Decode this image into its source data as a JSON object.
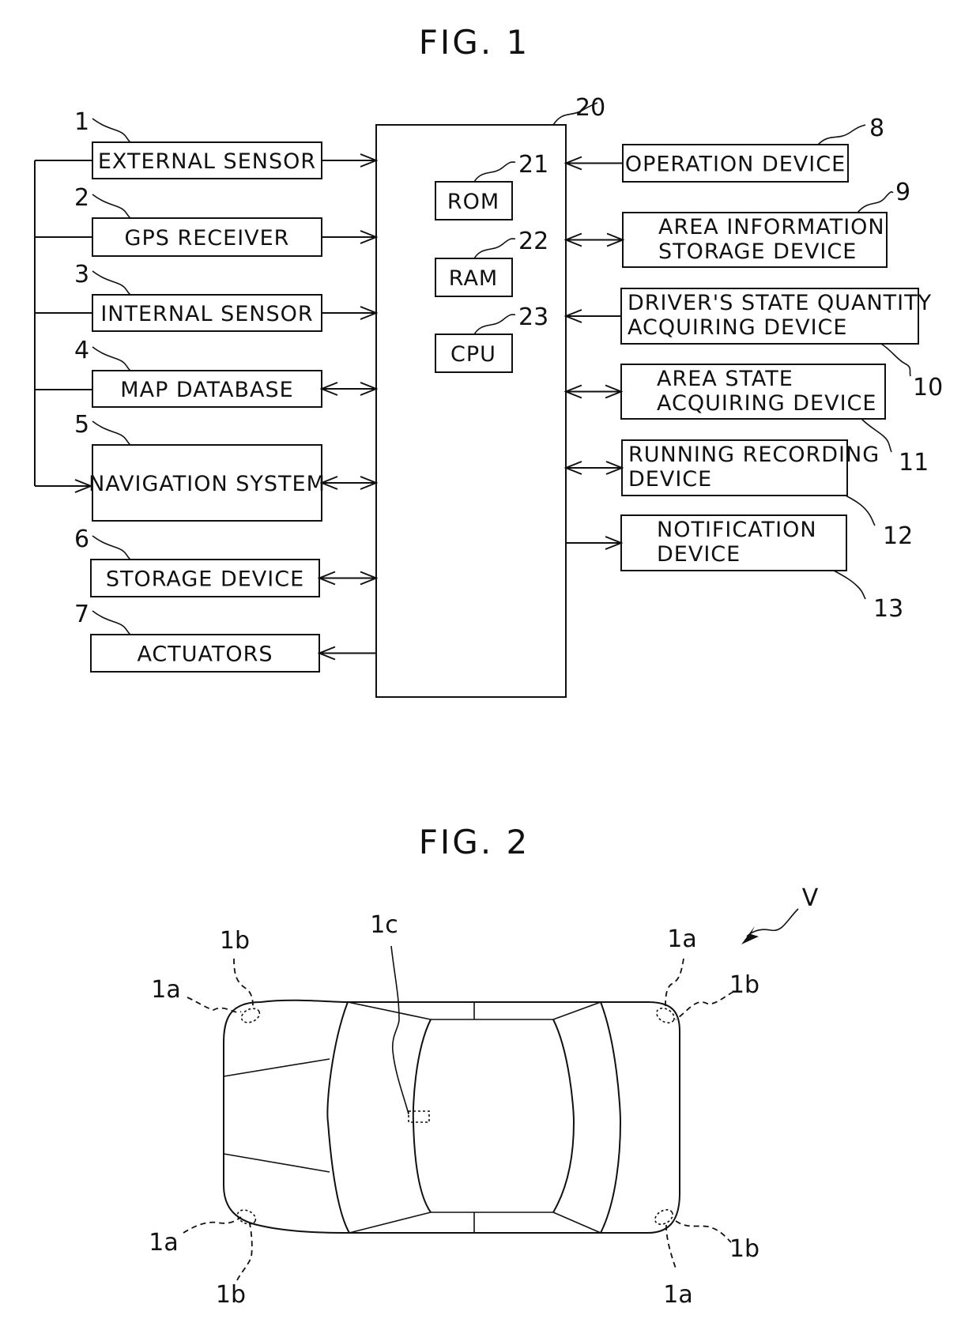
{
  "fig1": {
    "title": "FIG. 1",
    "controller": {
      "ref": "20"
    },
    "internal_blocks": [
      {
        "ref": "21",
        "label": "ROM"
      },
      {
        "ref": "22",
        "label": "RAM"
      },
      {
        "ref": "23",
        "label": "CPU"
      }
    ],
    "left_blocks": [
      {
        "ref": "1",
        "label": "EXTERNAL SENSOR",
        "arrow": "to-controller"
      },
      {
        "ref": "2",
        "label": "GPS RECEIVER",
        "arrow": "to-controller"
      },
      {
        "ref": "3",
        "label": "INTERNAL SENSOR",
        "arrow": "to-controller"
      },
      {
        "ref": "4",
        "label": "MAP DATABASE",
        "arrow": "bidirectional"
      },
      {
        "ref": "5",
        "label": "NAVIGATION SYSTEM",
        "arrow": "bidirectional"
      },
      {
        "ref": "6",
        "label": "STORAGE DEVICE",
        "arrow": "bidirectional"
      },
      {
        "ref": "7",
        "label": "ACTUATORS",
        "arrow": "from-controller"
      }
    ],
    "right_blocks": [
      {
        "ref": "8",
        "lines": [
          "OPERATION DEVICE"
        ],
        "arrow": "to-controller"
      },
      {
        "ref": "9",
        "lines": [
          "AREA INFORMATION",
          "STORAGE DEVICE"
        ],
        "arrow": "bidirectional"
      },
      {
        "ref": "10",
        "lines": [
          "DRIVER'S STATE QUANTITY",
          "ACQUIRING DEVICE"
        ],
        "arrow": "to-controller"
      },
      {
        "ref": "11",
        "lines": [
          "AREA STATE",
          "ACQUIRING DEVICE"
        ],
        "arrow": "bidirectional"
      },
      {
        "ref": "12",
        "lines": [
          "RUNNING RECORDING",
          "DEVICE"
        ],
        "arrow": "bidirectional"
      },
      {
        "ref": "13",
        "lines": [
          "NOTIFICATION",
          "DEVICE"
        ],
        "arrow": "from-controller"
      }
    ]
  },
  "fig2": {
    "title": "FIG. 2",
    "vehicle_ref": "V",
    "sensor_labels": {
      "front_left_radar": "1a",
      "front_left_lidar": "1b",
      "camera": "1c",
      "front_right_radar": "1a",
      "front_right_lidar": "1b",
      "rear_left_radar": "1a",
      "rear_left_lidar": "1b",
      "rear_right_radar": "1a",
      "rear_right_lidar": "1b"
    }
  }
}
